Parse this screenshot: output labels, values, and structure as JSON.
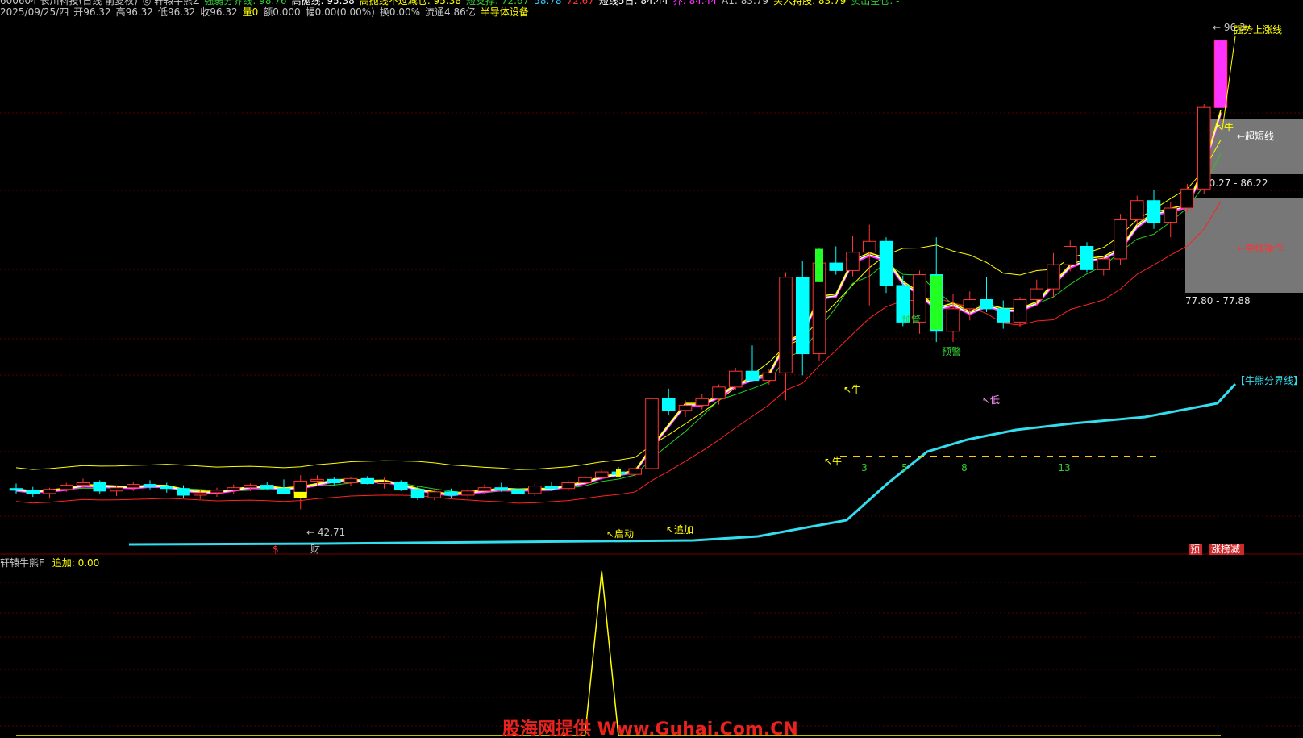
{
  "header": {
    "line1": [
      {
        "text": "600604 长川科技(日线 前复权)",
        "color": "#c8c8c8"
      },
      {
        "text": "◎ 轩辕牛熊Z",
        "color": "#c8c8c8"
      },
      {
        "text": "强弱分界线: 98.76",
        "color": "#33cc33"
      },
      {
        "text": "高抛线: 95.38",
        "color": "#ffffff"
      },
      {
        "text": "高抛线不过减仓: 95.38",
        "color": "#ffff00"
      },
      {
        "text": "短支撑: 72.67",
        "color": "#33cc33"
      },
      {
        "text": "58.78",
        "color": "#33ccff"
      },
      {
        "text": "72.67",
        "color": "#ff3333"
      },
      {
        "text": "短线5日: 84.44",
        "color": "#ffffff"
      },
      {
        "text": "乔: 84.44",
        "color": "#ff33ff"
      },
      {
        "text": "A1: 83.79",
        "color": "#c8c8c8"
      },
      {
        "text": "买入持股: 83.79",
        "color": "#ffff00"
      },
      {
        "text": "卖出空仓: -",
        "color": "#33cc33"
      }
    ],
    "line2": [
      {
        "text": "2025/09/25/四",
        "color": "#c8c8c8"
      },
      {
        "text": "开96.32",
        "color": "#c8c8c8"
      },
      {
        "text": "高96.32",
        "color": "#c8c8c8"
      },
      {
        "text": "低96.32",
        "color": "#c8c8c8"
      },
      {
        "text": "收96.32",
        "color": "#c8c8c8"
      },
      {
        "text": "量0",
        "color": "#ffff00"
      },
      {
        "text": "额0.000",
        "color": "#c8c8c8"
      },
      {
        "text": "幅0.00(0.00%)",
        "color": "#c8c8c8"
      },
      {
        "text": "换0.00%",
        "color": "#c8c8c8"
      },
      {
        "text": "流通4.86亿",
        "color": "#c8c8c8"
      },
      {
        "text": "半导体设备",
        "color": "#ffff00"
      }
    ]
  },
  "chart_data": {
    "type": "candlestick",
    "ylim": [
      38,
      101
    ],
    "candles": [
      [
        45.2,
        45.8,
        44.6,
        45.0
      ],
      [
        45.0,
        45.4,
        44.2,
        44.6
      ],
      [
        44.6,
        45.3,
        44.0,
        45.1
      ],
      [
        45.1,
        45.9,
        44.8,
        45.6
      ],
      [
        45.6,
        46.4,
        45.2,
        45.9
      ],
      [
        45.9,
        46.2,
        44.6,
        44.9
      ],
      [
        44.9,
        45.5,
        44.3,
        45.3
      ],
      [
        45.3,
        46.0,
        44.9,
        45.7
      ],
      [
        45.7,
        46.2,
        45.1,
        45.4
      ],
      [
        45.4,
        45.9,
        44.7,
        45.2
      ],
      [
        45.2,
        45.6,
        44.1,
        44.4
      ],
      [
        44.4,
        45.0,
        43.9,
        44.7
      ],
      [
        44.7,
        45.3,
        44.2,
        45.0
      ],
      [
        45.0,
        45.7,
        44.6,
        45.3
      ],
      [
        45.3,
        45.8,
        44.9,
        45.6
      ],
      [
        45.6,
        46.0,
        45.0,
        45.2
      ],
      [
        45.2,
        46.3,
        44.8,
        44.6
      ],
      [
        44.6,
        46.8,
        42.7,
        46.1
      ],
      [
        46.1,
        46.8,
        45.5,
        46.3
      ],
      [
        46.3,
        46.6,
        45.6,
        45.9
      ],
      [
        45.9,
        46.6,
        45.5,
        46.4
      ],
      [
        46.4,
        46.7,
        45.7,
        45.8
      ],
      [
        45.8,
        46.5,
        45.2,
        46.0
      ],
      [
        46.0,
        46.2,
        44.9,
        45.1
      ],
      [
        45.1,
        45.5,
        43.8,
        44.1
      ],
      [
        44.1,
        45.0,
        43.8,
        44.8
      ],
      [
        44.8,
        45.2,
        44.1,
        44.4
      ],
      [
        44.4,
        45.2,
        44.0,
        44.9
      ],
      [
        44.9,
        45.7,
        44.5,
        45.3
      ],
      [
        45.3,
        45.9,
        44.8,
        45.1
      ],
      [
        45.1,
        45.4,
        44.2,
        44.6
      ],
      [
        44.6,
        45.8,
        44.3,
        45.5
      ],
      [
        45.5,
        46.0,
        44.9,
        45.2
      ],
      [
        45.2,
        46.2,
        44.9,
        45.9
      ],
      [
        45.9,
        46.8,
        45.5,
        46.5
      ],
      [
        46.5,
        47.6,
        46.1,
        47.2
      ],
      [
        47.2,
        47.8,
        46.7,
        46.9
      ],
      [
        46.9,
        47.9,
        46.6,
        47.6
      ],
      [
        47.6,
        58.6,
        47.3,
        56.0
      ],
      [
        56.0,
        57.2,
        54.1,
        54.6
      ],
      [
        54.6,
        55.8,
        53.8,
        55.2
      ],
      [
        55.2,
        56.6,
        54.7,
        56.0
      ],
      [
        56.0,
        57.7,
        55.3,
        57.4
      ],
      [
        57.4,
        59.7,
        57.0,
        59.3
      ],
      [
        59.3,
        62.4,
        58.9,
        58.2
      ],
      [
        58.2,
        59.6,
        57.7,
        59.1
      ],
      [
        59.1,
        71.2,
        55.8,
        70.6
      ],
      [
        70.6,
        72.6,
        58.8,
        61.4
      ],
      [
        61.4,
        74.1,
        60.6,
        72.3
      ],
      [
        72.3,
        74.3,
        70.9,
        71.4
      ],
      [
        71.4,
        75.6,
        70.7,
        73.6
      ],
      [
        73.6,
        76.9,
        67.2,
        74.9
      ],
      [
        74.9,
        75.4,
        68.7,
        69.6
      ],
      [
        69.6,
        70.8,
        64.7,
        65.2
      ],
      [
        65.2,
        71.4,
        63.8,
        70.9
      ],
      [
        70.9,
        75.4,
        62.8,
        64.1
      ],
      [
        64.1,
        68.6,
        62.8,
        66.8
      ],
      [
        66.8,
        68.9,
        65.4,
        67.9
      ],
      [
        67.9,
        70.6,
        66.4,
        66.8
      ],
      [
        66.8,
        67.8,
        64.4,
        65.2
      ],
      [
        65.2,
        68.2,
        64.6,
        67.9
      ],
      [
        67.9,
        70.3,
        67.2,
        69.2
      ],
      [
        69.2,
        73.5,
        68.1,
        72.1
      ],
      [
        72.1,
        75.0,
        71.3,
        74.3
      ],
      [
        74.3,
        74.8,
        71.2,
        71.5
      ],
      [
        71.5,
        73.1,
        70.8,
        72.8
      ],
      [
        72.8,
        78.2,
        72.1,
        77.5
      ],
      [
        77.5,
        80.4,
        76.9,
        79.8
      ],
      [
        79.8,
        81.1,
        76.4,
        77.2
      ],
      [
        77.2,
        79.6,
        75.4,
        78.9
      ],
      [
        78.9,
        81.8,
        78.3,
        81.2
      ],
      [
        81.2,
        91.4,
        80.6,
        91.0
      ],
      [
        91.0,
        99.0,
        91.0,
        99.0
      ]
    ],
    "price_labels": {
      "low_marker": "42.71",
      "high_marker": "96.3"
    },
    "zones": [
      {
        "label": "80.27 - 86.22"
      },
      {
        "label": "77.80 - 77.88"
      }
    ],
    "line_labels": [
      "强势上涨线",
      "←超短线",
      "←中线操作",
      "【牛熊分界线】"
    ],
    "signals": {
      "start": "启动",
      "add": "追加",
      "bull": "牛",
      "warn": "预警",
      "dot": "低"
    },
    "counters": [
      "3",
      "5",
      "8",
      "13"
    ],
    "bottom_markers": [
      {
        "text": "$",
        "color": "#ff3333"
      },
      {
        "text": "财",
        "color": "#c8c8c8"
      },
      {
        "text": "预",
        "color": "#ffffff",
        "bg": "#cc2a2a"
      },
      {
        "text": "涨榜减",
        "color": "#ffffff",
        "bg": "#cc2a2a"
      }
    ],
    "sub_indicator": {
      "name": "轩辕牛熊F",
      "value_label": "追加: 0.00",
      "values": [
        0,
        0,
        0,
        0,
        0,
        0,
        0,
        0,
        0,
        0,
        0,
        0,
        0,
        0,
        0,
        0,
        0,
        0,
        0,
        0,
        0,
        0,
        0,
        0,
        0,
        0,
        0,
        0,
        0,
        0,
        0,
        0,
        0,
        0,
        0,
        1,
        0,
        0,
        0,
        0,
        0,
        0,
        0,
        0,
        0,
        0,
        0,
        0,
        0,
        0,
        0,
        0,
        0,
        0,
        0,
        0,
        0,
        0,
        0,
        0,
        0,
        0,
        0,
        0,
        0,
        0,
        0,
        0,
        0,
        0,
        0,
        0,
        0
      ],
      "ylim": [
        0,
        1
      ]
    }
  },
  "watermark": "股海网提供 Www.Guhai.Com.CN",
  "colors": {
    "up": "#ff3333",
    "down": "#00ffff",
    "background": "#000000",
    "grid": "#5a0000"
  }
}
